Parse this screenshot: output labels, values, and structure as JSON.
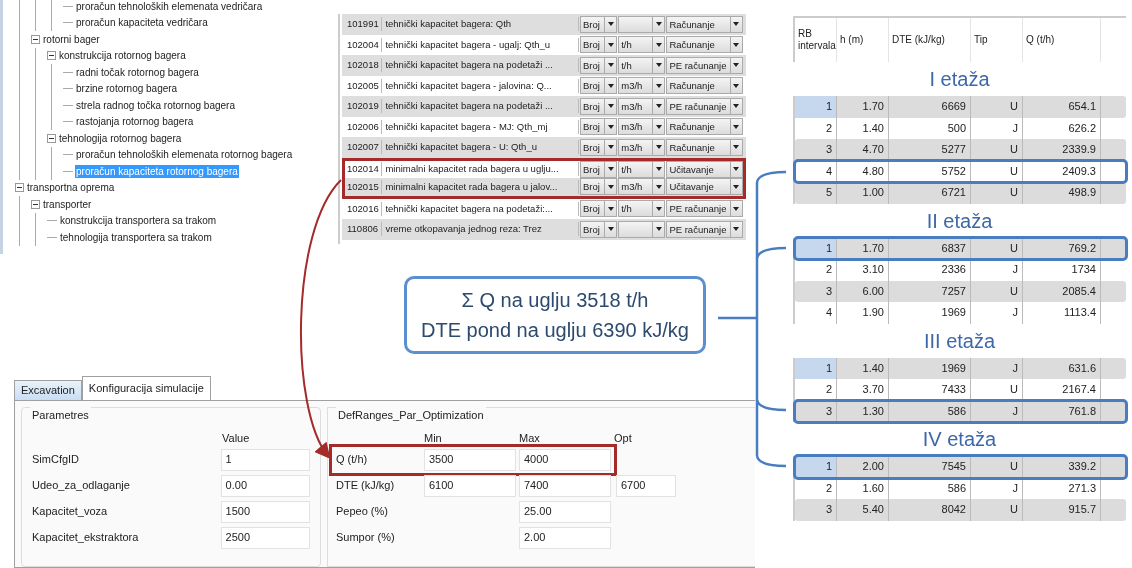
{
  "tree": {
    "nodes": [
      {
        "children": [
          {
            "children": [
              {
                "children": [
                  {
                    "label": "proračun tehnoloških elemenata vedričara",
                    "selected": false
                  },
                  {
                    "label": "proračun kapaciteta vedričara",
                    "selected": false
                  }
                ]
              }
            ]
          },
          {
            "label": "rotorni bager",
            "expanded": true,
            "selected": false,
            "children": [
              {
                "label": "konstrukcija rotornog bagera",
                "expanded": true,
                "selected": false,
                "children": [
                  {
                    "label": "radni točak rotornog bagera",
                    "selected": false
                  },
                  {
                    "label": "brzine rotornog bagera",
                    "selected": false
                  },
                  {
                    "label": "strela radnog točka rotornog bagera",
                    "selected": false
                  },
                  {
                    "label": "rastojanja rotornog bagera",
                    "selected": false
                  }
                ]
              },
              {
                "label": "tehnologija rotornog bagera",
                "expanded": true,
                "selected": false,
                "children": [
                  {
                    "label": "proračun tehnoloških elemenata rotornog bagera",
                    "selected": false
                  },
                  {
                    "label": "proračun kapaciteta rotornog bagera",
                    "selected": true
                  }
                ]
              }
            ]
          }
        ]
      },
      {
        "label": "transportna oprema",
        "expanded": true,
        "selected": false,
        "children": [
          {
            "label": "transporter",
            "expanded": true,
            "selected": false,
            "children": [
              {
                "label": "konstrukcija transportera sa trakom",
                "selected": false
              },
              {
                "label": "tehnologija transportera sa trakom",
                "selected": false
              }
            ]
          }
        ]
      }
    ]
  },
  "grid": {
    "rows": [
      {
        "id": "101991",
        "name": "tehnički kapacitet bagera: Qth",
        "type": "Broj",
        "unit": "",
        "mode": "Računanje",
        "highlighted": false
      },
      {
        "id": "102004",
        "name": "tehnički kapacitet bagera - ugalj: Qth_u",
        "type": "Broj",
        "unit": "t/h",
        "mode": "Računanje",
        "highlighted": false
      },
      {
        "id": "102018",
        "name": "tehnički kapacitet bagera na podetaži ...",
        "type": "Broj",
        "unit": "t/h",
        "mode": "PE računanje",
        "highlighted": false
      },
      {
        "id": "102005",
        "name": "tehnički kapacitet  bagera - jalovina: Q...",
        "type": "Broj",
        "unit": "m3/h",
        "mode": "Računanje",
        "highlighted": false
      },
      {
        "id": "102019",
        "name": "tehnički kapacitet bagera na podetaži ...",
        "type": "Broj",
        "unit": "m3/h",
        "mode": "PE računanje",
        "highlighted": false
      },
      {
        "id": "102006",
        "name": "tehnički kapacitet  bagera - MJ: Qth_mj",
        "type": "Broj",
        "unit": "m3/h",
        "mode": "Računanje",
        "highlighted": false
      },
      {
        "id": "102007",
        "name": "tehnički kapacitet  bagera - U: Qth_u",
        "type": "Broj",
        "unit": "m3/h",
        "mode": "Računanje",
        "highlighted": false
      },
      {
        "id": "102014",
        "name": "minimalni kapacitet rada bagera u uglju...",
        "type": "Broj",
        "unit": "t/h",
        "mode": "Učitavanje",
        "highlighted": true
      },
      {
        "id": "102015",
        "name": "minimalni kapacitet rada bagera u jalov...",
        "type": "Broj",
        "unit": "m3/h",
        "mode": "Učitavanje",
        "highlighted": true
      },
      {
        "id": "102016",
        "name": "tehnički kapacitet bagera na podetaži:...",
        "type": "Broj",
        "unit": "t/h",
        "mode": "PE računanje",
        "highlighted": false
      },
      {
        "id": "110806",
        "name": "vreme otkopavanja jednog reza: Trez",
        "type": "Broj",
        "unit": "",
        "mode": "PE računanje",
        "highlighted": false
      }
    ]
  },
  "summary_callout": {
    "lines": [
      "Σ Q na uglju 3518 t/h",
      "DTE pond na uglju 6390 kJ/kg"
    ]
  },
  "interval_tables": {
    "columns": [
      "RB intervala",
      "h (m)",
      "DTE (kJ/kg)",
      "Tip",
      "Q (t/h)"
    ],
    "sections": [
      {
        "title": "I etaža",
        "rows": [
          {
            "cells": [
              "1",
              "1.70",
              "6669",
              "U",
              "654.1"
            ],
            "selected": true,
            "highlighted": false
          },
          {
            "cells": [
              "2",
              "1.40",
              "500",
              "J",
              "626.2"
            ],
            "selected": false,
            "highlighted": false
          },
          {
            "cells": [
              "3",
              "4.70",
              "5277",
              "U",
              "2339.9"
            ],
            "selected": false,
            "highlighted": false
          },
          {
            "cells": [
              "4",
              "4.80",
              "5752",
              "U",
              "2409.3"
            ],
            "selected": false,
            "highlighted": true
          },
          {
            "cells": [
              "5",
              "1.00",
              "6721",
              "U",
              "498.9"
            ],
            "selected": false,
            "highlighted": false
          }
        ]
      },
      {
        "title": "II etaža",
        "rows": [
          {
            "cells": [
              "1",
              "1.70",
              "6837",
              "U",
              "769.2"
            ],
            "selected": true,
            "highlighted": true
          },
          {
            "cells": [
              "2",
              "3.10",
              "2336",
              "J",
              "1734"
            ],
            "selected": false,
            "highlighted": false
          },
          {
            "cells": [
              "3",
              "6.00",
              "7257",
              "U",
              "2085.4"
            ],
            "selected": false,
            "highlighted": false
          },
          {
            "cells": [
              "4",
              "1.90",
              "1969",
              "J",
              "1113.4"
            ],
            "selected": false,
            "highlighted": false
          }
        ]
      },
      {
        "title": "III etaža",
        "rows": [
          {
            "cells": [
              "1",
              "1.40",
              "1969",
              "J",
              "631.6"
            ],
            "selected": true,
            "highlighted": false
          },
          {
            "cells": [
              "2",
              "3.70",
              "7433",
              "U",
              "2167.4"
            ],
            "selected": false,
            "highlighted": false
          },
          {
            "cells": [
              "3",
              "1.30",
              "586",
              "J",
              "761.8"
            ],
            "selected": false,
            "highlighted": true
          }
        ]
      },
      {
        "title": "IV etaža",
        "rows": [
          {
            "cells": [
              "1",
              "2.00",
              "7545",
              "U",
              "339.2"
            ],
            "selected": true,
            "highlighted": true
          },
          {
            "cells": [
              "2",
              "1.60",
              "586",
              "J",
              "271.3"
            ],
            "selected": false,
            "highlighted": false
          },
          {
            "cells": [
              "3",
              "5.40",
              "8042",
              "U",
              "915.7"
            ],
            "selected": false,
            "highlighted": false
          }
        ]
      }
    ]
  },
  "config": {
    "tabs": [
      {
        "label": "Excavation",
        "selected": false
      },
      {
        "label": "Konfiguracija simulacije",
        "selected": true
      }
    ],
    "parametres": {
      "title": "Parametres",
      "value_header": "Value",
      "fields": [
        {
          "label": "SimCfgID",
          "value": "1"
        },
        {
          "label": "Udeo_za_odlaganje",
          "value": "0.00"
        },
        {
          "label": "Kapacitet_voza",
          "value": "1500"
        },
        {
          "label": "Kapacitet_ekstraktora",
          "value": "2500"
        }
      ]
    },
    "ranges": {
      "title": "DefRanges_Par_Optimization",
      "columns": [
        "Min",
        "Max",
        "Opt"
      ],
      "rows": [
        {
          "label": "Q (t/h)",
          "min": "3500",
          "max": "4000",
          "opt": "",
          "highlighted": true
        },
        {
          "label": "DTE (kJ/kg)",
          "min": "6100",
          "max": "7400",
          "opt": "6700",
          "highlighted": false
        },
        {
          "label": "Pepeo (%)",
          "min": "",
          "max": "25.00",
          "opt": "",
          "highlighted": false
        },
        {
          "label": "Sumpor (%)",
          "min": "",
          "max": "2.00",
          "opt": "",
          "highlighted": false
        }
      ]
    }
  }
}
